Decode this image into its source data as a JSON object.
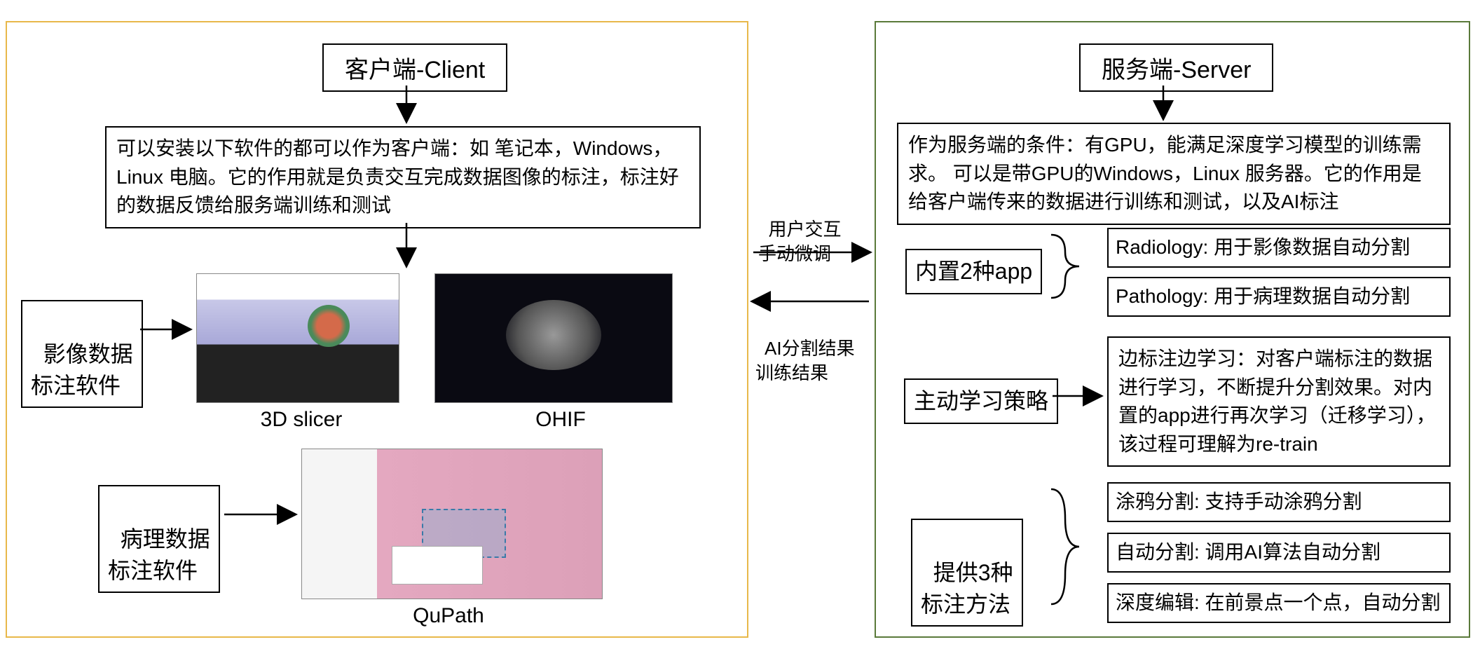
{
  "client": {
    "title": "客户端-Client",
    "desc": "可以安装以下软件的都可以作为客户端：如 笔记本，Windows，Linux 电脑。它的作用就是负责交互完成数据图像的标注，标注好的数据反馈给服务端训练和测试",
    "imaging_label": "影像数据\n标注软件",
    "pathology_label": "病理数据\n标注软件",
    "sw1": "3D slicer",
    "sw2": "OHIF",
    "sw3": "QuPath"
  },
  "center": {
    "top_label": "用户交互\n手动微调",
    "bottom_label": "AI分割结果\n训练结果"
  },
  "server": {
    "title": "服务端-Server",
    "desc": "作为服务端的条件：有GPU，能满足深度学习模型的训练需求。 可以是带GPU的Windows，Linux 服务器。它的作用是给客户端传来的数据进行训练和测试，以及AI标注",
    "apps_label": "内置2种app",
    "app1": "Radiology: 用于影像数据自动分割",
    "app2": "Pathology: 用于病理数据自动分割",
    "active_label": "主动学习策略",
    "active_desc": "边标注边学习：对客户端标注的数据进行学习，不断提升分割效果。对内置的app进行再次学习（迁移学习），该过程可理解为re-train",
    "methods_label": "提供3种\n标注方法",
    "m1": "涂鸦分割: 支持手动涂鸦分割",
    "m2": "自动分割: 调用AI算法自动分割",
    "m3": "深度编辑: 在前景点一个点，自动分割"
  }
}
